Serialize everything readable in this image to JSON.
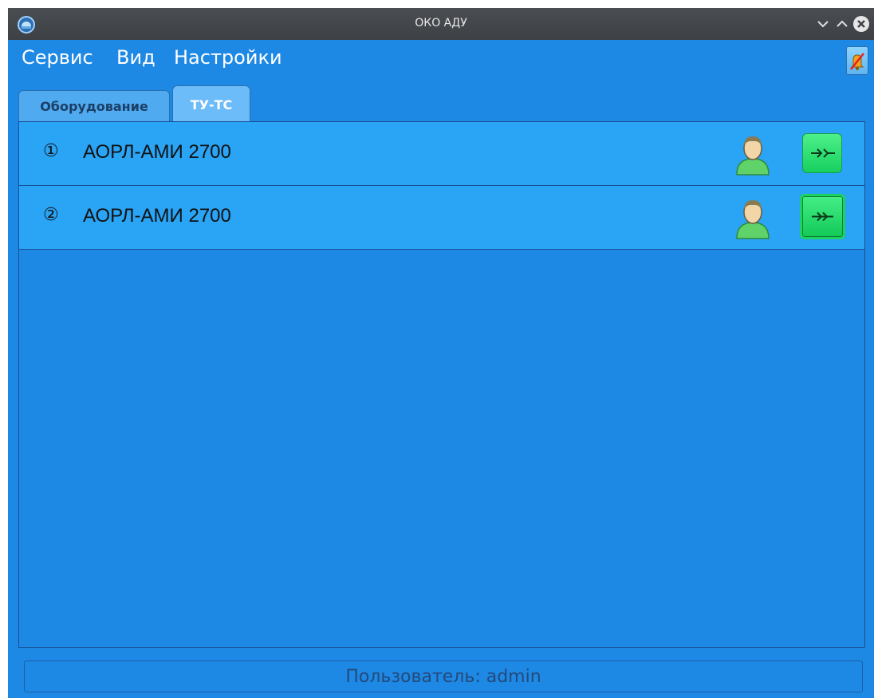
{
  "window": {
    "title": "ОКО АДУ"
  },
  "menu": {
    "items": [
      "Сервис",
      "Вид",
      "Настройки"
    ]
  },
  "tabs": [
    {
      "label": "Оборудование",
      "active": false
    },
    {
      "label": "ТУ-ТС",
      "active": true
    }
  ],
  "rows": [
    {
      "number": "①",
      "name": "АОРЛ-АМИ 2700",
      "user_icon": "user-icon",
      "action_icon": "arrow-converge-icon"
    },
    {
      "number": "②",
      "name": "АОРЛ-АМИ 2700",
      "user_icon": "user-icon",
      "action_icon": "arrow-through-icon"
    }
  ],
  "status": {
    "text": "Пользователь: admin"
  },
  "colors": {
    "background": "#1e88e5",
    "row": "#2aa4f5",
    "button_green": "#1bd35d"
  }
}
